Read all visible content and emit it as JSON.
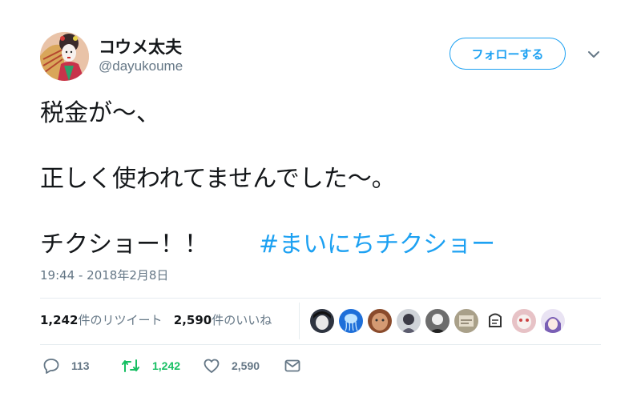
{
  "author": {
    "display_name": "コウメ太夫",
    "handle": "@dayukoume"
  },
  "follow_button": {
    "label": "フォローする"
  },
  "tweet": {
    "lines": [
      "税金が～、",
      "正しく使われてませんでした～。",
      "チクショー！！"
    ],
    "hashtag": "#まいにちチクショー",
    "timestamp": "19:44 - 2018年2月8日"
  },
  "stats": {
    "retweet_count": "1,242",
    "retweet_label": "件のリツイート",
    "like_count": "2,590",
    "like_label": "件のいいね"
  },
  "actions": {
    "reply_count": "113",
    "retweet_count": "1,242",
    "like_count": "2,590"
  },
  "colors": {
    "accent": "#1da1f2",
    "retweet_green": "#17bf63",
    "secondary_text": "#657786",
    "divider": "#e6ecf0"
  },
  "icons": [
    "chevron-down-icon",
    "reply-icon",
    "retweet-icon",
    "heart-icon",
    "envelope-icon"
  ]
}
